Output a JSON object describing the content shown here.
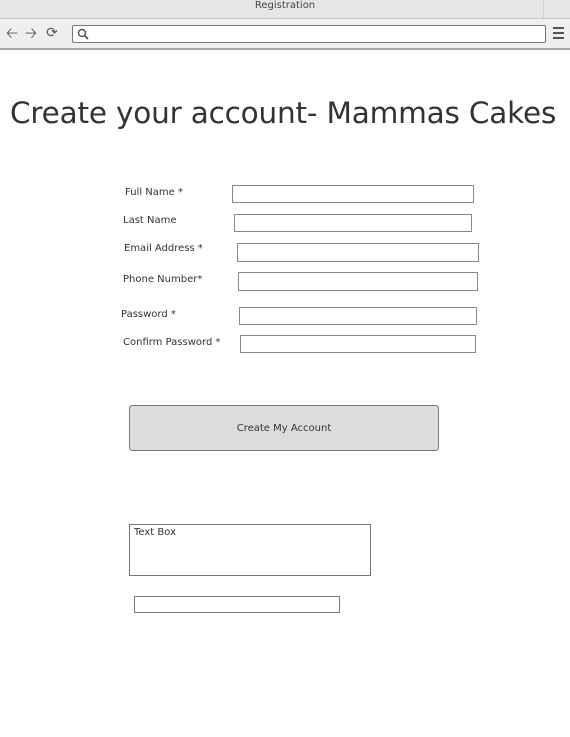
{
  "window": {
    "title": "Registration"
  },
  "browser": {
    "address_value": ""
  },
  "page": {
    "title": "Create your account- Mammas Cakes"
  },
  "form": {
    "fields": [
      {
        "label": "Full Name *",
        "value": ""
      },
      {
        "label": "Last Name",
        "value": ""
      },
      {
        "label": "Email Address *",
        "value": ""
      },
      {
        "label": "Phone Number*",
        "value": ""
      },
      {
        "label": "Password *",
        "value": ""
      },
      {
        "label": "Confirm Password *",
        "value": ""
      }
    ],
    "submit_label": "Create My Account"
  },
  "text_box": {
    "value": "Text Box"
  },
  "extra_input": {
    "value": ""
  },
  "icons": {
    "back": "back-arrow-icon",
    "forward": "forward-arrow-icon",
    "reload": "reload-icon",
    "search": "search-icon",
    "menu": "hamburger-menu-icon"
  }
}
